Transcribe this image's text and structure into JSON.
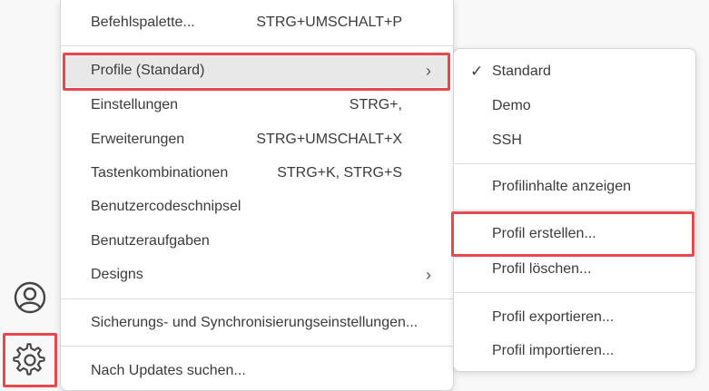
{
  "activity_bar": {
    "icons": [
      {
        "name": "accounts-icon"
      },
      {
        "name": "gear-icon"
      }
    ]
  },
  "main_menu": {
    "command_palette": {
      "label": "Befehlspalette...",
      "shortcut": "STRG+UMSCHALT+P"
    },
    "profiles": {
      "label": "Profile (Standard)",
      "arrow": "›"
    },
    "settings": {
      "label": "Einstellungen",
      "shortcut": "STRG+,"
    },
    "extensions": {
      "label": "Erweiterungen",
      "shortcut": "STRG+UMSCHALT+X"
    },
    "keyboard_shortcuts": {
      "label": "Tastenkombinationen",
      "shortcut": "STRG+K, STRG+S"
    },
    "user_snippets": {
      "label": "Benutzercodeschnipsel"
    },
    "user_tasks": {
      "label": "Benutzeraufgaben"
    },
    "themes": {
      "label": "Designs",
      "arrow": "›"
    },
    "backup_sync": {
      "label": "Sicherungs- und Synchronisierungseinstellungen..."
    },
    "check_updates": {
      "label": "Nach Updates suchen..."
    }
  },
  "profiles_submenu": {
    "profiles": [
      {
        "label": "Standard",
        "checked": true,
        "check_glyph": "✓"
      },
      {
        "label": "Demo",
        "checked": false
      },
      {
        "label": "SSH",
        "checked": false
      }
    ],
    "show_contents": "Profilinhalte anzeigen",
    "create": "Profil erstellen...",
    "delete": "Profil löschen...",
    "export": "Profil exportieren...",
    "import": "Profil importieren..."
  }
}
